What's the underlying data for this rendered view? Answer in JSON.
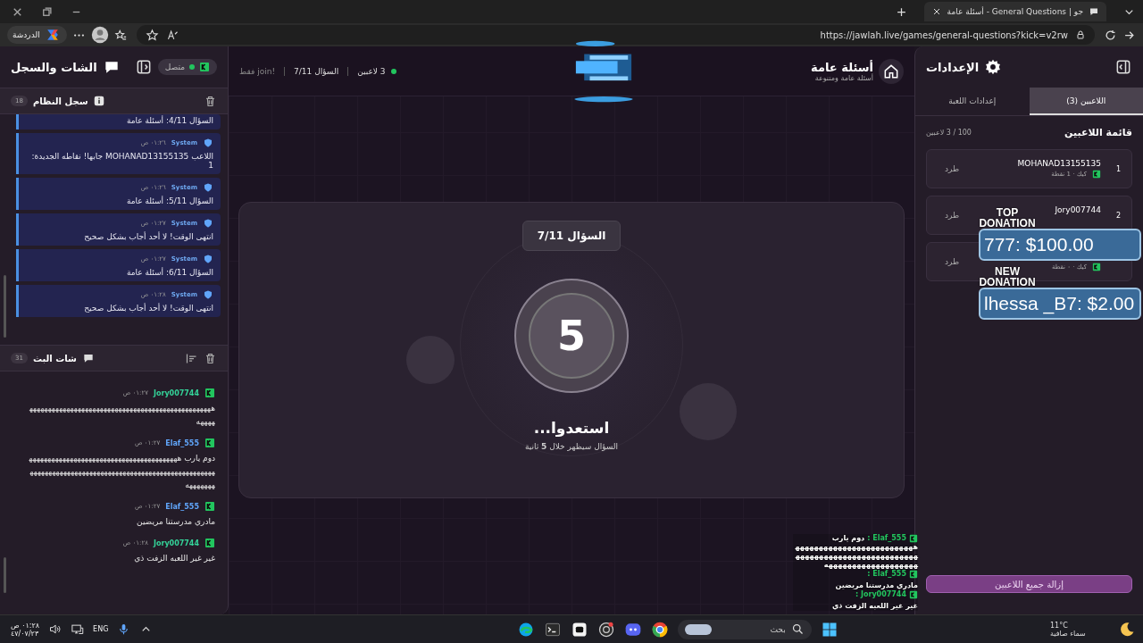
{
  "browser": {
    "tab_title": "أسئلة عامة - General Questions | جو",
    "copilot_label": "الدردشة",
    "url": "https://jawlah.live/games/general-questions?kick=v2rw"
  },
  "left_panel": {
    "title": "الشات والسجل",
    "status": {
      "label": "متصل",
      "connected": true
    },
    "system_log": {
      "title": "سجل النظام",
      "count": "18",
      "messages": [
        {
          "text": "السؤال 4/11: أسئلة عامة"
        },
        {
          "author": "System",
          "time": "٠١:٢٦ ص",
          "text": "اللاعب MOHANAD13155135 جابها! نقاطه الجديدة: 1"
        },
        {
          "author": "System",
          "time": "٠١:٢٦ ص",
          "text": "السؤال 5/11: أسئلة عامة"
        },
        {
          "author": "System",
          "time": "٠١:٢٧ ص",
          "text": "انتهى الوقت! لا أحد أجاب بشكل صحيح"
        },
        {
          "author": "System",
          "time": "٠١:٢٧ ص",
          "text": "السؤال 6/11: أسئلة عامة"
        },
        {
          "author": "System",
          "time": "٠١:٢٨ ص",
          "text": "انتهى الوقت! لا أحد أجاب بشكل صحيح"
        }
      ]
    },
    "live_chat": {
      "title": "شات البث",
      "count": "31",
      "messages": [
        {
          "user": "Jory007744",
          "color": "#34d399",
          "time": "٠١:٢٧ ص",
          "text": "ههههههههههههههههههههههههههههههههههههههههههههههههههههههه"
        },
        {
          "user": "Elaf_555",
          "color": "#60a5fa",
          "time": "٠١:٢٧ ص",
          "text": "دوم يارب ههههههههههههههههههههههههههههههههههههههههههههههههههههههههههههههههههههههههههههههههههههههههههههههههههه"
        },
        {
          "user": "Elaf_555",
          "color": "#60a5fa",
          "time": "٠١:٢٧ ص",
          "text": "مادري مدرستنا مريضين"
        },
        {
          "user": "Jory007744",
          "color": "#34d399",
          "time": "٠١:٢٨ ص",
          "text": "غير غير اللعبه الزفت ذي"
        }
      ]
    }
  },
  "header": {
    "title": "أسئلة عامة",
    "subtitle": "أسئلة عامة ومتنوعة",
    "players": "3 لاعبين",
    "question": "السؤال 7/11",
    "join_hint": "!join فقط"
  },
  "card": {
    "badge": "السؤال 7/11",
    "countdown": "5",
    "title": "استعدوا...",
    "subtitle": "السؤال سيظهر خلال **5** ثانية"
  },
  "right_panel": {
    "title": "الإعدادات",
    "tabs": [
      {
        "label": "اللاعبين (3)",
        "selected": true
      },
      {
        "label": "إعدادات اللعبة",
        "selected": false
      }
    ],
    "list_title": "قائمة اللاعبين",
    "list_count": "100 / 3 لاعبين",
    "players": [
      {
        "rank": "1",
        "name": "MOHANAD13155135",
        "meta": "كيك · 1 نقطة",
        "kick": "طرد"
      },
      {
        "rank": "2",
        "name": "Jory007744",
        "kick": "طرد"
      },
      {
        "meta": "كيك · ٠ نقطة",
        "kick": "طرد"
      }
    ],
    "remove_all": "إزالة جميع اللاعبين"
  },
  "donations": [
    {
      "label": "TOP DONATION",
      "text": "777: $100.00"
    },
    {
      "label": "NEW DONATION",
      "text": "lhessa _B7: $2.00"
    }
  ],
  "chat_overlay": [
    {
      "user": "Elaf_555 :",
      "text": "دوم يارب"
    },
    {
      "text": "هههههههههههههههههههههههههههههههههههههههههههههههههههههههههههههههههههههههه"
    },
    {
      "user": "Elaf_555 :",
      "text": "مادري مدرستنا مريضين"
    },
    {
      "user": "Jory007744 :",
      "text": "غير غير اللعبه الزفت ذي"
    }
  ],
  "taskbar": {
    "time": "٠١:٢٨ ص",
    "date": "٤٧/٠٧/٢٣",
    "language": "ENG",
    "search_placeholder": "بحث",
    "temperature": "11°C",
    "weather": "سماء صافية"
  }
}
